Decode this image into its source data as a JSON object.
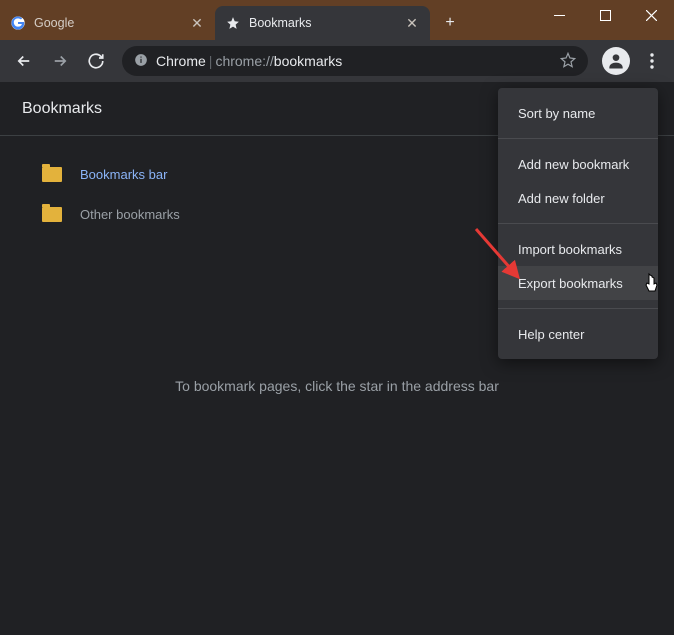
{
  "tabs": [
    {
      "title": "Google"
    },
    {
      "title": "Bookmarks"
    }
  ],
  "omnibox": {
    "chrome_label": "Chrome",
    "path_prefix": "chrome://",
    "path_page": "bookmarks"
  },
  "page": {
    "title": "Bookmarks",
    "hint": "To bookmark pages, click the star in the address bar"
  },
  "folders": [
    {
      "label": "Bookmarks bar",
      "active": true
    },
    {
      "label": "Other bookmarks",
      "active": false
    }
  ],
  "menu": {
    "sort": "Sort by name",
    "add_bookmark": "Add new bookmark",
    "add_folder": "Add new folder",
    "import": "Import bookmarks",
    "export": "Export bookmarks",
    "help": "Help center"
  }
}
